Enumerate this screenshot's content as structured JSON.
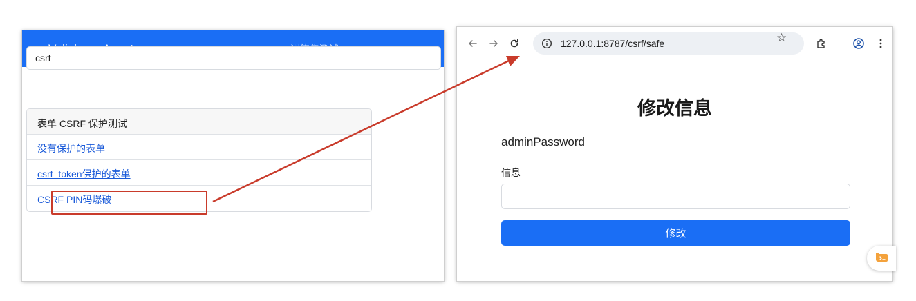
{
  "left_window": {
    "brand": "Vulinbox - Agent",
    "nav_links": [
      "yaklang.io",
      "WS Proto Agent",
      "AI 训练集测试：AI-Knowledge-B"
    ],
    "search": {
      "value": "csrf"
    },
    "list": {
      "header": "表单 CSRF 保护测试",
      "items": [
        "没有保护的表单",
        "csrf_token保护的表单",
        "CSRF PIN码爆破"
      ]
    }
  },
  "right_window": {
    "toolbar": {
      "url": "127.0.0.1:8787/csrf/safe",
      "icons": [
        "back-icon",
        "forward-icon",
        "reload-icon",
        "info-icon",
        "star-icon",
        "extensions-icon",
        "profile-icon",
        "menu-icon"
      ]
    },
    "page": {
      "title": "修改信息",
      "username": "adminPassword",
      "field_label": "信息",
      "field_value": "",
      "submit_label": "修改"
    }
  },
  "colors": {
    "navbar": "#1a6ef5",
    "link": "#1a5ad9",
    "annotation": "#c93b2b",
    "button": "#1a6ef5"
  }
}
